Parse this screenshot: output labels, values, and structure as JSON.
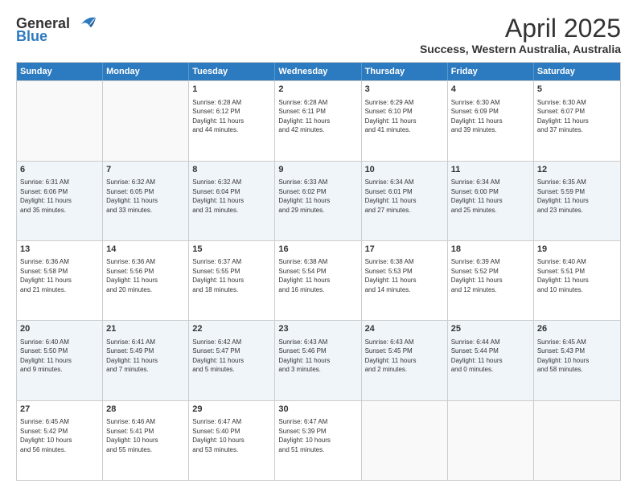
{
  "header": {
    "logo_general": "General",
    "logo_blue": "Blue",
    "title": "April 2025",
    "subtitle": "Success, Western Australia, Australia"
  },
  "days": [
    "Sunday",
    "Monday",
    "Tuesday",
    "Wednesday",
    "Thursday",
    "Friday",
    "Saturday"
  ],
  "weeks": [
    [
      {
        "day": "",
        "lines": []
      },
      {
        "day": "",
        "lines": []
      },
      {
        "day": "1",
        "lines": [
          "Sunrise: 6:28 AM",
          "Sunset: 6:12 PM",
          "Daylight: 11 hours",
          "and 44 minutes."
        ]
      },
      {
        "day": "2",
        "lines": [
          "Sunrise: 6:28 AM",
          "Sunset: 6:11 PM",
          "Daylight: 11 hours",
          "and 42 minutes."
        ]
      },
      {
        "day": "3",
        "lines": [
          "Sunrise: 6:29 AM",
          "Sunset: 6:10 PM",
          "Daylight: 11 hours",
          "and 41 minutes."
        ]
      },
      {
        "day": "4",
        "lines": [
          "Sunrise: 6:30 AM",
          "Sunset: 6:09 PM",
          "Daylight: 11 hours",
          "and 39 minutes."
        ]
      },
      {
        "day": "5",
        "lines": [
          "Sunrise: 6:30 AM",
          "Sunset: 6:07 PM",
          "Daylight: 11 hours",
          "and 37 minutes."
        ]
      }
    ],
    [
      {
        "day": "6",
        "lines": [
          "Sunrise: 6:31 AM",
          "Sunset: 6:06 PM",
          "Daylight: 11 hours",
          "and 35 minutes."
        ]
      },
      {
        "day": "7",
        "lines": [
          "Sunrise: 6:32 AM",
          "Sunset: 6:05 PM",
          "Daylight: 11 hours",
          "and 33 minutes."
        ]
      },
      {
        "day": "8",
        "lines": [
          "Sunrise: 6:32 AM",
          "Sunset: 6:04 PM",
          "Daylight: 11 hours",
          "and 31 minutes."
        ]
      },
      {
        "day": "9",
        "lines": [
          "Sunrise: 6:33 AM",
          "Sunset: 6:02 PM",
          "Daylight: 11 hours",
          "and 29 minutes."
        ]
      },
      {
        "day": "10",
        "lines": [
          "Sunrise: 6:34 AM",
          "Sunset: 6:01 PM",
          "Daylight: 11 hours",
          "and 27 minutes."
        ]
      },
      {
        "day": "11",
        "lines": [
          "Sunrise: 6:34 AM",
          "Sunset: 6:00 PM",
          "Daylight: 11 hours",
          "and 25 minutes."
        ]
      },
      {
        "day": "12",
        "lines": [
          "Sunrise: 6:35 AM",
          "Sunset: 5:59 PM",
          "Daylight: 11 hours",
          "and 23 minutes."
        ]
      }
    ],
    [
      {
        "day": "13",
        "lines": [
          "Sunrise: 6:36 AM",
          "Sunset: 5:58 PM",
          "Daylight: 11 hours",
          "and 21 minutes."
        ]
      },
      {
        "day": "14",
        "lines": [
          "Sunrise: 6:36 AM",
          "Sunset: 5:56 PM",
          "Daylight: 11 hours",
          "and 20 minutes."
        ]
      },
      {
        "day": "15",
        "lines": [
          "Sunrise: 6:37 AM",
          "Sunset: 5:55 PM",
          "Daylight: 11 hours",
          "and 18 minutes."
        ]
      },
      {
        "day": "16",
        "lines": [
          "Sunrise: 6:38 AM",
          "Sunset: 5:54 PM",
          "Daylight: 11 hours",
          "and 16 minutes."
        ]
      },
      {
        "day": "17",
        "lines": [
          "Sunrise: 6:38 AM",
          "Sunset: 5:53 PM",
          "Daylight: 11 hours",
          "and 14 minutes."
        ]
      },
      {
        "day": "18",
        "lines": [
          "Sunrise: 6:39 AM",
          "Sunset: 5:52 PM",
          "Daylight: 11 hours",
          "and 12 minutes."
        ]
      },
      {
        "day": "19",
        "lines": [
          "Sunrise: 6:40 AM",
          "Sunset: 5:51 PM",
          "Daylight: 11 hours",
          "and 10 minutes."
        ]
      }
    ],
    [
      {
        "day": "20",
        "lines": [
          "Sunrise: 6:40 AM",
          "Sunset: 5:50 PM",
          "Daylight: 11 hours",
          "and 9 minutes."
        ]
      },
      {
        "day": "21",
        "lines": [
          "Sunrise: 6:41 AM",
          "Sunset: 5:49 PM",
          "Daylight: 11 hours",
          "and 7 minutes."
        ]
      },
      {
        "day": "22",
        "lines": [
          "Sunrise: 6:42 AM",
          "Sunset: 5:47 PM",
          "Daylight: 11 hours",
          "and 5 minutes."
        ]
      },
      {
        "day": "23",
        "lines": [
          "Sunrise: 6:43 AM",
          "Sunset: 5:46 PM",
          "Daylight: 11 hours",
          "and 3 minutes."
        ]
      },
      {
        "day": "24",
        "lines": [
          "Sunrise: 6:43 AM",
          "Sunset: 5:45 PM",
          "Daylight: 11 hours",
          "and 2 minutes."
        ]
      },
      {
        "day": "25",
        "lines": [
          "Sunrise: 6:44 AM",
          "Sunset: 5:44 PM",
          "Daylight: 11 hours",
          "and 0 minutes."
        ]
      },
      {
        "day": "26",
        "lines": [
          "Sunrise: 6:45 AM",
          "Sunset: 5:43 PM",
          "Daylight: 10 hours",
          "and 58 minutes."
        ]
      }
    ],
    [
      {
        "day": "27",
        "lines": [
          "Sunrise: 6:45 AM",
          "Sunset: 5:42 PM",
          "Daylight: 10 hours",
          "and 56 minutes."
        ]
      },
      {
        "day": "28",
        "lines": [
          "Sunrise: 6:46 AM",
          "Sunset: 5:41 PM",
          "Daylight: 10 hours",
          "and 55 minutes."
        ]
      },
      {
        "day": "29",
        "lines": [
          "Sunrise: 6:47 AM",
          "Sunset: 5:40 PM",
          "Daylight: 10 hours",
          "and 53 minutes."
        ]
      },
      {
        "day": "30",
        "lines": [
          "Sunrise: 6:47 AM",
          "Sunset: 5:39 PM",
          "Daylight: 10 hours",
          "and 51 minutes."
        ]
      },
      {
        "day": "",
        "lines": []
      },
      {
        "day": "",
        "lines": []
      },
      {
        "day": "",
        "lines": []
      }
    ]
  ]
}
